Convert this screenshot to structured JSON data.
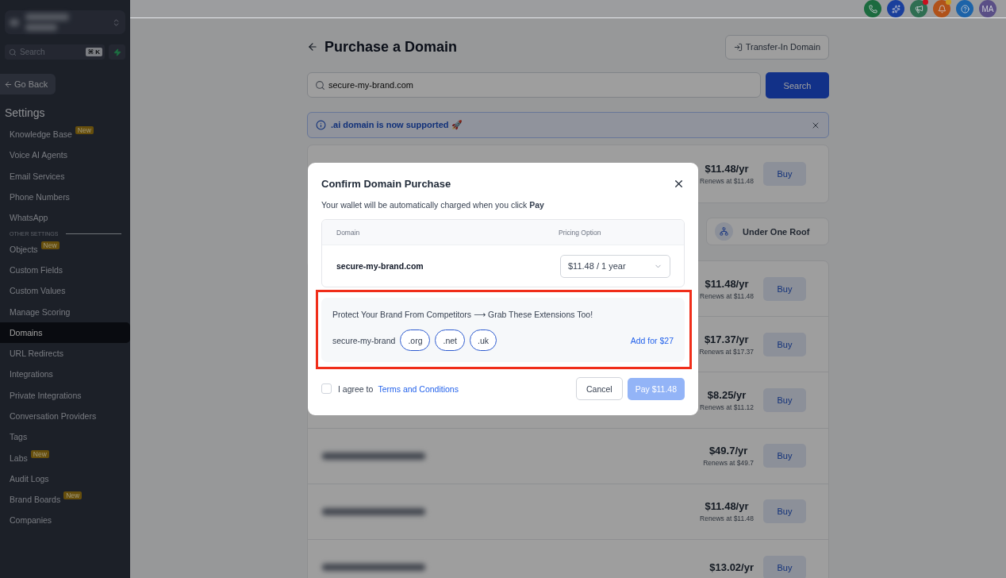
{
  "topbar": {
    "icons": [
      {
        "kind": "phone",
        "color": "#1c6b3f",
        "notification": false
      },
      {
        "kind": "sparkle",
        "color": "#1a3f9c",
        "notification": false
      },
      {
        "kind": "megaphone",
        "color": "#2f6e52",
        "notification": true
      },
      {
        "kind": "bell",
        "color": "#b0521a",
        "notification": true
      },
      {
        "kind": "help",
        "color": "#1d63a8",
        "notification": false
      }
    ],
    "avatar": "MA"
  },
  "sidebar": {
    "search_placeholder": "Search",
    "shortcut": "⌘ K",
    "back": "Go Back",
    "heading": "Settings",
    "groups": [
      {
        "items": [
          {
            "label": "Knowledge Base",
            "badge": "New",
            "selected": false
          },
          {
            "label": "Voice AI Agents",
            "selected": false
          },
          {
            "label": "Email Services",
            "selected": false
          },
          {
            "label": "Phone Numbers",
            "selected": false
          },
          {
            "label": "WhatsApp",
            "selected": false
          }
        ]
      },
      {
        "title": "OTHER SETTINGS",
        "items": [
          {
            "label": "Objects",
            "badge": "New",
            "selected": false
          },
          {
            "label": "Custom Fields",
            "selected": false
          },
          {
            "label": "Custom Values",
            "selected": false
          },
          {
            "label": "Manage Scoring",
            "selected": false
          },
          {
            "label": "Domains",
            "selected": true
          },
          {
            "label": "URL Redirects",
            "selected": false
          },
          {
            "label": "Integrations",
            "selected": false
          },
          {
            "label": "Private Integrations",
            "selected": false
          },
          {
            "label": "Conversation Providers",
            "selected": false
          },
          {
            "label": "Tags",
            "selected": false
          },
          {
            "label": "Labs",
            "badge": "New",
            "selected": false
          },
          {
            "label": "Audit Logs",
            "selected": false
          },
          {
            "label": "Brand Boards",
            "badge": "New",
            "selected": false
          },
          {
            "label": "Companies",
            "selected": false
          }
        ]
      }
    ]
  },
  "page": {
    "title": "Purchase a Domain",
    "transfer_button": "Transfer-In Domain",
    "search_value": "secure-my-brand.com",
    "search_button": "Search",
    "banner": ".ai domain is now supported 🚀",
    "featured": {
      "price": "$11.48/yr",
      "renews": "Renews at $11.48",
      "buy": "Buy"
    },
    "group_button": "Under One Roof",
    "results": [
      {
        "kind": "covered",
        "price": "$11.48/yr",
        "renews": "Renews at $11.48",
        "buy": "Buy"
      },
      {
        "kind": "covered",
        "price": "$17.37/yr",
        "renews": "Renews at $17.37",
        "buy": "Buy"
      },
      {
        "kind": "covered",
        "price": "$8.25/yr",
        "renews": "Renews at $11.12",
        "buy": "Buy"
      },
      {
        "kind": "blurred",
        "price": "$49.7/yr",
        "renews": "Renews at $49.7",
        "buy": "Buy"
      },
      {
        "kind": "blurred",
        "price": "$11.48/yr",
        "renews": "Renews at $11.48",
        "buy": "Buy"
      },
      {
        "kind": "blurred",
        "price": "$13.02/yr",
        "buy": "Buy"
      }
    ]
  },
  "modal": {
    "title": "Confirm Domain Purchase",
    "subtitle": "Your wallet will be automatically charged when you click **Pay**",
    "columns": [
      "Domain",
      "Pricing Option"
    ],
    "domain": "secure-my-brand.com",
    "pricing": "$11.48 / 1 year",
    "upsell": {
      "heading": "Protect Your Brand From Competitors ⟶ Grab These Extensions Too!",
      "base": "secure-my-brand",
      "extensions": [
        ".org",
        ".net",
        ".uk"
      ],
      "add": "Add for $27",
      "highlighted": true
    },
    "agree": {
      "checked": false,
      "label": "I agree to",
      "link": "Terms and Conditions"
    },
    "cancel": "Cancel",
    "pay": {
      "label": "Pay $11.48",
      "disabled": true
    }
  }
}
